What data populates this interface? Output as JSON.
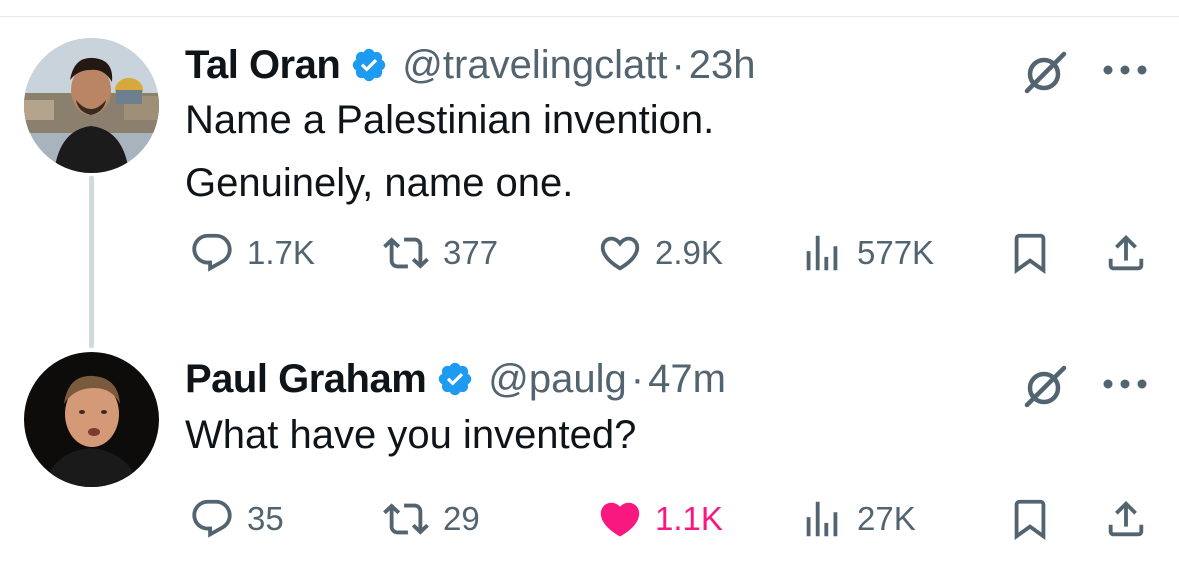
{
  "tweets": [
    {
      "name": "Tal Oran",
      "handle": "@travelingclatt",
      "separator": "·",
      "time": "23h",
      "text_lines": [
        "Name a Palestinian invention.",
        "Genuinely, name one."
      ],
      "replies": "1.7K",
      "reposts": "377",
      "likes": "2.9K",
      "liked": false,
      "views": "577K"
    },
    {
      "name": "Paul Graham",
      "handle": "@paulg",
      "separator": "·",
      "time": "47m",
      "text_lines": [
        "What have you invented?"
      ],
      "replies": "35",
      "reposts": "29",
      "likes": "1.1K",
      "liked": true,
      "views": "27K"
    }
  ],
  "colors": {
    "verified": "#1d9bf0",
    "muted": "#536471",
    "like_active": "#f91880",
    "thread_line": "#cfd9de"
  },
  "icons": [
    "verified-badge-icon",
    "grok-icon",
    "more-icon",
    "reply-icon",
    "repost-icon",
    "like-icon",
    "views-icon",
    "bookmark-icon",
    "share-icon"
  ]
}
